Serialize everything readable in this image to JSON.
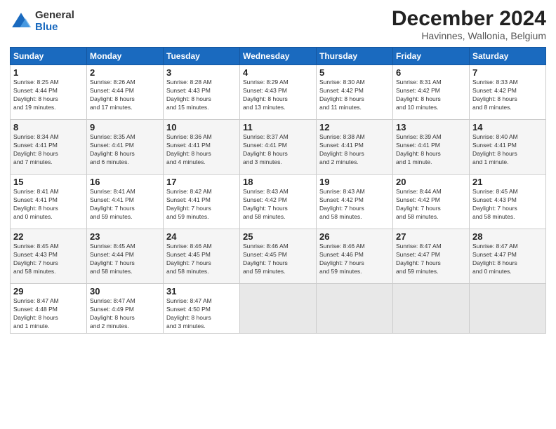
{
  "header": {
    "logo_general": "General",
    "logo_blue": "Blue",
    "month": "December 2024",
    "location": "Havinnes, Wallonia, Belgium"
  },
  "days_of_week": [
    "Sunday",
    "Monday",
    "Tuesday",
    "Wednesday",
    "Thursday",
    "Friday",
    "Saturday"
  ],
  "weeks": [
    [
      {
        "day": "1",
        "info": "Sunrise: 8:25 AM\nSunset: 4:44 PM\nDaylight: 8 hours\nand 19 minutes."
      },
      {
        "day": "2",
        "info": "Sunrise: 8:26 AM\nSunset: 4:44 PM\nDaylight: 8 hours\nand 17 minutes."
      },
      {
        "day": "3",
        "info": "Sunrise: 8:28 AM\nSunset: 4:43 PM\nDaylight: 8 hours\nand 15 minutes."
      },
      {
        "day": "4",
        "info": "Sunrise: 8:29 AM\nSunset: 4:43 PM\nDaylight: 8 hours\nand 13 minutes."
      },
      {
        "day": "5",
        "info": "Sunrise: 8:30 AM\nSunset: 4:42 PM\nDaylight: 8 hours\nand 11 minutes."
      },
      {
        "day": "6",
        "info": "Sunrise: 8:31 AM\nSunset: 4:42 PM\nDaylight: 8 hours\nand 10 minutes."
      },
      {
        "day": "7",
        "info": "Sunrise: 8:33 AM\nSunset: 4:42 PM\nDaylight: 8 hours\nand 8 minutes."
      }
    ],
    [
      {
        "day": "8",
        "info": "Sunrise: 8:34 AM\nSunset: 4:41 PM\nDaylight: 8 hours\nand 7 minutes."
      },
      {
        "day": "9",
        "info": "Sunrise: 8:35 AM\nSunset: 4:41 PM\nDaylight: 8 hours\nand 6 minutes."
      },
      {
        "day": "10",
        "info": "Sunrise: 8:36 AM\nSunset: 4:41 PM\nDaylight: 8 hours\nand 4 minutes."
      },
      {
        "day": "11",
        "info": "Sunrise: 8:37 AM\nSunset: 4:41 PM\nDaylight: 8 hours\nand 3 minutes."
      },
      {
        "day": "12",
        "info": "Sunrise: 8:38 AM\nSunset: 4:41 PM\nDaylight: 8 hours\nand 2 minutes."
      },
      {
        "day": "13",
        "info": "Sunrise: 8:39 AM\nSunset: 4:41 PM\nDaylight: 8 hours\nand 1 minute."
      },
      {
        "day": "14",
        "info": "Sunrise: 8:40 AM\nSunset: 4:41 PM\nDaylight: 8 hours\nand 1 minute."
      }
    ],
    [
      {
        "day": "15",
        "info": "Sunrise: 8:41 AM\nSunset: 4:41 PM\nDaylight: 8 hours\nand 0 minutes."
      },
      {
        "day": "16",
        "info": "Sunrise: 8:41 AM\nSunset: 4:41 PM\nDaylight: 7 hours\nand 59 minutes."
      },
      {
        "day": "17",
        "info": "Sunrise: 8:42 AM\nSunset: 4:41 PM\nDaylight: 7 hours\nand 59 minutes."
      },
      {
        "day": "18",
        "info": "Sunrise: 8:43 AM\nSunset: 4:42 PM\nDaylight: 7 hours\nand 58 minutes."
      },
      {
        "day": "19",
        "info": "Sunrise: 8:43 AM\nSunset: 4:42 PM\nDaylight: 7 hours\nand 58 minutes."
      },
      {
        "day": "20",
        "info": "Sunrise: 8:44 AM\nSunset: 4:42 PM\nDaylight: 7 hours\nand 58 minutes."
      },
      {
        "day": "21",
        "info": "Sunrise: 8:45 AM\nSunset: 4:43 PM\nDaylight: 7 hours\nand 58 minutes."
      }
    ],
    [
      {
        "day": "22",
        "info": "Sunrise: 8:45 AM\nSunset: 4:43 PM\nDaylight: 7 hours\nand 58 minutes."
      },
      {
        "day": "23",
        "info": "Sunrise: 8:45 AM\nSunset: 4:44 PM\nDaylight: 7 hours\nand 58 minutes."
      },
      {
        "day": "24",
        "info": "Sunrise: 8:46 AM\nSunset: 4:45 PM\nDaylight: 7 hours\nand 58 minutes."
      },
      {
        "day": "25",
        "info": "Sunrise: 8:46 AM\nSunset: 4:45 PM\nDaylight: 7 hours\nand 59 minutes."
      },
      {
        "day": "26",
        "info": "Sunrise: 8:46 AM\nSunset: 4:46 PM\nDaylight: 7 hours\nand 59 minutes."
      },
      {
        "day": "27",
        "info": "Sunrise: 8:47 AM\nSunset: 4:47 PM\nDaylight: 7 hours\nand 59 minutes."
      },
      {
        "day": "28",
        "info": "Sunrise: 8:47 AM\nSunset: 4:47 PM\nDaylight: 8 hours\nand 0 minutes."
      }
    ],
    [
      {
        "day": "29",
        "info": "Sunrise: 8:47 AM\nSunset: 4:48 PM\nDaylight: 8 hours\nand 1 minute."
      },
      {
        "day": "30",
        "info": "Sunrise: 8:47 AM\nSunset: 4:49 PM\nDaylight: 8 hours\nand 2 minutes."
      },
      {
        "day": "31",
        "info": "Sunrise: 8:47 AM\nSunset: 4:50 PM\nDaylight: 8 hours\nand 3 minutes."
      },
      {
        "day": "",
        "info": ""
      },
      {
        "day": "",
        "info": ""
      },
      {
        "day": "",
        "info": ""
      },
      {
        "day": "",
        "info": ""
      }
    ]
  ]
}
